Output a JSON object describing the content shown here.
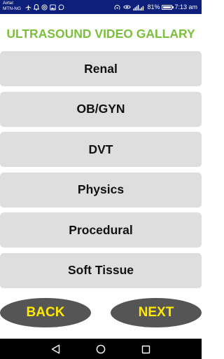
{
  "status_bar": {
    "carrier_line1": "Airtel",
    "carrier_line2": "MTN-NG",
    "battery": "81%",
    "time": "7:13 am",
    "notification_icons": [
      "airplane-icon",
      "bell-icon",
      "at-sign-icon",
      "gallery-icon",
      "whatsapp-icon"
    ],
    "system_icons": [
      "hotspot-icon",
      "eye-icon",
      "signal-icon",
      "battery-icon"
    ]
  },
  "title": "ULTRASOUND VIDEO GALLARY",
  "categories": [
    {
      "label": "Renal"
    },
    {
      "label": "OB/GYN"
    },
    {
      "label": "DVT"
    },
    {
      "label": "Physics"
    },
    {
      "label": "Procedural"
    },
    {
      "label": "Soft Tissue"
    }
  ],
  "navigation": {
    "back_label": "BACK",
    "next_label": "NEXT"
  },
  "system_nav": [
    "back-triangle-icon",
    "home-circle-icon",
    "recents-square-icon"
  ],
  "colors": {
    "status_bar": "#0c1f7a",
    "title": "#7cbf3c",
    "category_button": "#dedede",
    "pill_button": "#555555",
    "pill_text": "#ffea00",
    "system_nav": "#000000"
  }
}
